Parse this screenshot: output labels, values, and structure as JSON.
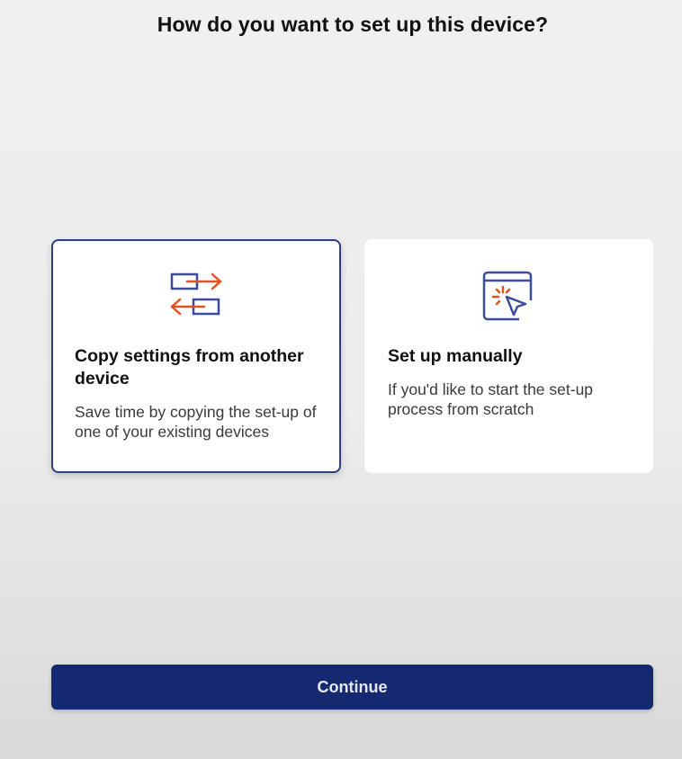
{
  "page": {
    "title": "How do you want to set up this device?"
  },
  "options": [
    {
      "title": "Copy settings from another device",
      "description": "Save time by copying the set-up of one of your existing devices",
      "icon": "transfer-arrows-icon",
      "selected": true
    },
    {
      "title": "Set up manually",
      "description": "If you'd like to start the set-up process from scratch",
      "icon": "window-cursor-icon",
      "selected": false
    }
  ],
  "actions": {
    "continue_label": "Continue"
  },
  "colors": {
    "accent": "#14296f",
    "selected_border": "#2b3f86",
    "icon_blue": "#3a4c9b",
    "icon_orange": "#e4501e",
    "card_background": "#ffffff"
  }
}
